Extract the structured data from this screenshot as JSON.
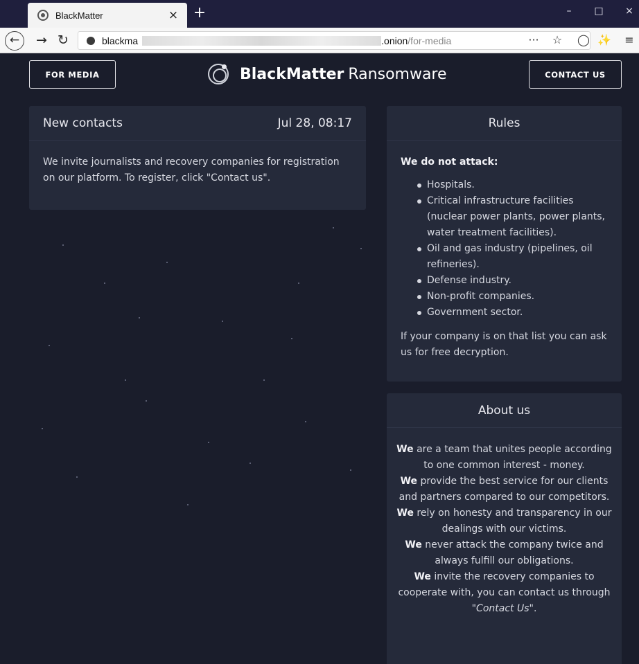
{
  "browser": {
    "tab_title": "BlackMatter",
    "tab_close": "×",
    "new_tab": "+",
    "minimize": "–",
    "maximize": "□",
    "close": "×",
    "url_host": "blackma",
    "url_tld": ".onion",
    "url_path": "/for-media",
    "page_actions": "···",
    "bookmark": "☆",
    "shield": "◯",
    "extension": "✨",
    "menu": "≡"
  },
  "header": {
    "for_media_label": "FOR MEDIA",
    "brand_bold": "BlackMatter",
    "brand_rest": "Ransomware",
    "contact_label": "CONTACT US"
  },
  "news": {
    "title": "New contacts",
    "date": "Jul 28, 08:17",
    "body": "We invite journalists and recovery companies for registration on our platform. To register, click \"Contact us\"."
  },
  "rules": {
    "title": "Rules",
    "heading": "We do not attack:",
    "items": [
      "Hospitals.",
      "Critical infrastructure facilities (nuclear power plants, power plants, water treatment facilities).",
      "Oil and gas industry (pipelines, oil refineries).",
      "Defense industry.",
      "Non-profit companies.",
      "Government sector."
    ],
    "note": "If your company is on that list you can ask us for free decryption."
  },
  "about": {
    "title": "About us",
    "lines": [
      {
        "bold": "We",
        "text": " are a team that unites people according to one common interest - money."
      },
      {
        "bold": "We",
        "text": " provide the best service for our clients and partners compared to our competitors."
      },
      {
        "bold": "We",
        "text": " rely on honesty and transparency in our dealings with our victims."
      },
      {
        "bold": "We",
        "text": " never attack the company twice and always fulfill our obligations."
      },
      {
        "bold": "We",
        "text": " invite the recovery companies to cooperate with, you can contact us through \"",
        "italic": "Contact Us",
        "tail": "\"."
      }
    ]
  }
}
